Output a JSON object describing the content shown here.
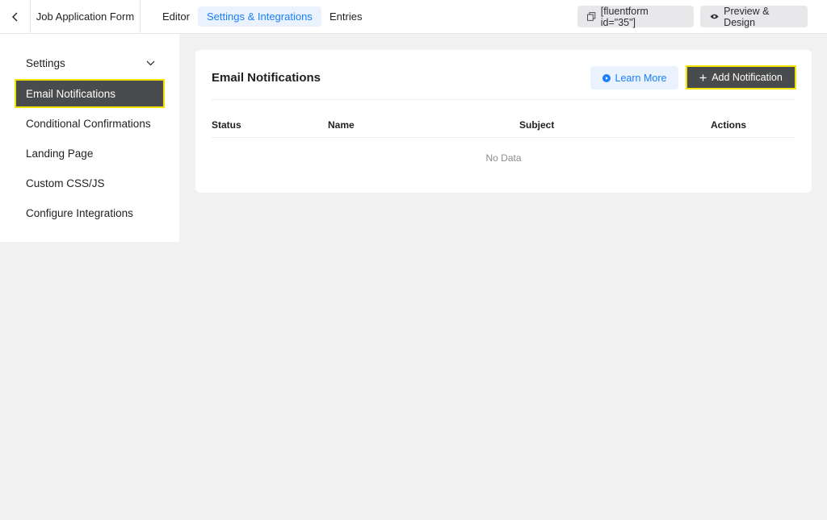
{
  "header": {
    "form_title": "Job Application Form",
    "tabs": [
      {
        "label": "Editor",
        "active": false
      },
      {
        "label": "Settings & Integrations",
        "active": true
      },
      {
        "label": "Entries",
        "active": false
      }
    ],
    "shortcode_label": "[fluentform id=\"35\"]",
    "preview_label": "Preview & Design"
  },
  "sidebar": {
    "items": [
      {
        "label": "Settings",
        "icon": "chevron-down-icon"
      },
      {
        "label": "Email Notifications",
        "active": true
      },
      {
        "label": "Conditional Confirmations"
      },
      {
        "label": "Landing Page"
      },
      {
        "label": "Custom CSS/JS"
      },
      {
        "label": "Configure Integrations"
      }
    ]
  },
  "main": {
    "title": "Email Notifications",
    "learn_more_label": "Learn More",
    "add_notification_label": "Add Notification",
    "table": {
      "columns": [
        "Status",
        "Name",
        "Subject",
        "Actions"
      ],
      "empty_text": "No Data"
    }
  },
  "colors": {
    "accent": "#1a7efb",
    "highlight": "#f2e300",
    "dark_button": "#4a4b4c"
  }
}
